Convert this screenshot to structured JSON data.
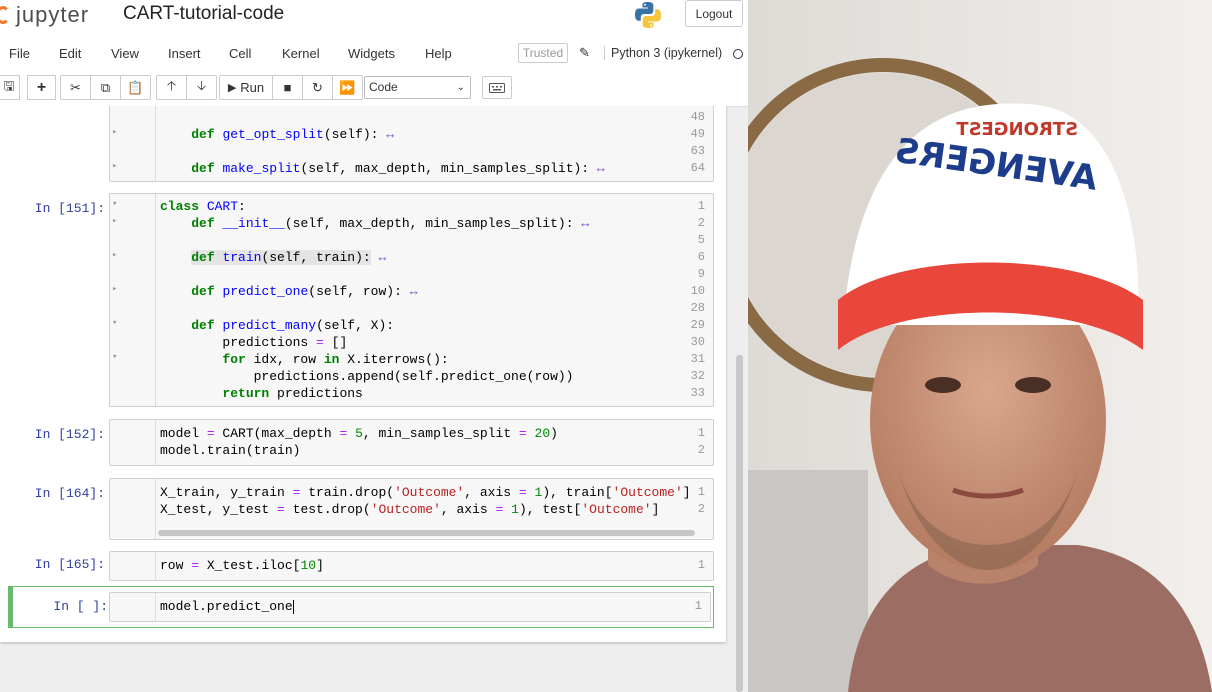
{
  "app": {
    "logo_text": "jupyter",
    "notebook_title": "CART-tutorial-code",
    "logout_label": "Logout"
  },
  "menu": {
    "items": [
      "File",
      "Edit",
      "View",
      "Insert",
      "Cell",
      "Kernel",
      "Widgets",
      "Help"
    ],
    "trusted_label": "Trusted",
    "kernel_label": "Python 3 (ipykernel)"
  },
  "toolbar": {
    "run_label": "Run",
    "cell_type": "Code"
  },
  "cells": {
    "c0": {
      "lines": [
        "48",
        "49",
        "63",
        "64"
      ]
    },
    "c1": {
      "prompt": "In [151]:"
    },
    "c2": {
      "prompt": "In [152]:"
    },
    "c3": {
      "prompt": "In [164]:"
    },
    "c4": {
      "prompt": "In [165]:"
    },
    "c5": {
      "prompt": "In [ ]:",
      "code": "model.predict_one"
    }
  },
  "colors": {
    "accent_orange": "#f37726",
    "selected_cell": "#66bb6a",
    "prompt_blue": "#303f9f",
    "keyword_green": "#008000"
  },
  "icons": [
    "save-icon",
    "plus-icon",
    "scissors-icon",
    "copy-icon",
    "paste-icon",
    "arrow-up-icon",
    "arrow-down-icon",
    "play-icon",
    "stop-icon",
    "restart-icon",
    "fast-forward-icon",
    "keyboard-icon",
    "pencil-icon",
    "python-logo-icon",
    "kernel-idle-icon"
  ]
}
